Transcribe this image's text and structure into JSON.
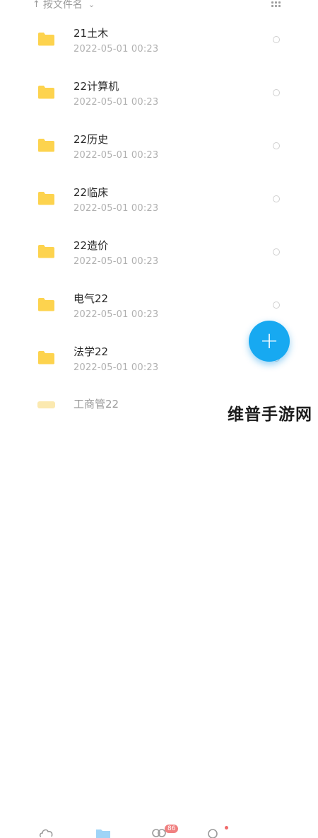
{
  "header": {
    "sort_arrow": "↑",
    "sort_label": "按文件名",
    "sort_chevron": "⌄",
    "view_toggle_icon": "grid-icon"
  },
  "files": [
    {
      "name": "21土木",
      "date": "2022-05-01",
      "time": "00:23"
    },
    {
      "name": "22计算机",
      "date": "2022-05-01",
      "time": "00:23"
    },
    {
      "name": "22历史",
      "date": "2022-05-01",
      "time": "00:23"
    },
    {
      "name": "22临床",
      "date": "2022-05-01",
      "time": "00:23"
    },
    {
      "name": "22造价",
      "date": "2022-05-01",
      "time": "00:23"
    },
    {
      "name": "电气22",
      "date": "2022-05-01",
      "time": "00:23"
    },
    {
      "name": "法学22",
      "date": "2022-05-01",
      "time": "00:23"
    }
  ],
  "partial_file": {
    "name": "工商管22"
  },
  "fab": {
    "label": "+"
  },
  "bottom_nav": {
    "badge": "86"
  },
  "watermark": "维普手游网",
  "colors": {
    "folder": "#fdd34e",
    "accent": "#17a9f1",
    "badge": "#f08080"
  }
}
